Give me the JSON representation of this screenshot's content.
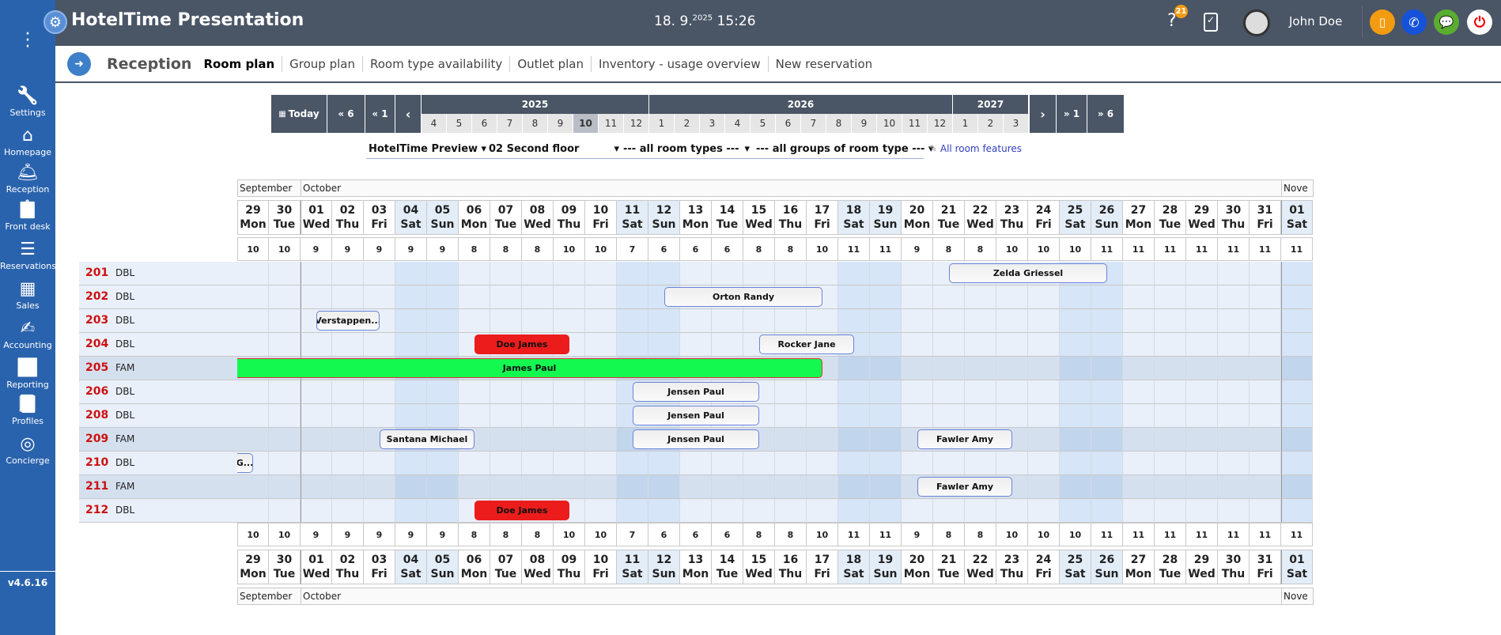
{
  "app": {
    "title": "HotelTime Presentation",
    "date": "18. 9.",
    "year": "2025",
    "time": "15:26",
    "help_badge": "21",
    "user": "John Doe",
    "version": "v4.6.16"
  },
  "colors": {
    "sidebar": "#2a63ad",
    "topbar": "#4a5566",
    "room_number": "#cc1111",
    "booking_red": "#ec1c1c",
    "booking_green": "#14f950",
    "booking_border": "#6a85d8",
    "weekend": "#e3edf8"
  },
  "sidebar": {
    "items": [
      {
        "label": "Settings",
        "icon": "wrench-icon"
      },
      {
        "label": "Homepage",
        "icon": "home-user-icon"
      },
      {
        "label": "Reception",
        "icon": "bell-icon"
      },
      {
        "label": "Front desk",
        "icon": "clipboard-check-icon"
      },
      {
        "label": "Reservations",
        "icon": "sliders-icon"
      },
      {
        "label": "Sales",
        "icon": "calculator-icon"
      },
      {
        "label": "Accounting",
        "icon": "pen-invoice-icon"
      },
      {
        "label": "Reporting",
        "icon": "chart-icon"
      },
      {
        "label": "Profiles",
        "icon": "phonebook-icon"
      },
      {
        "label": "Concierge",
        "icon": "target-icon"
      }
    ]
  },
  "nav": {
    "section": "Reception",
    "tabs": [
      "Room plan",
      "Group plan",
      "Room type availability",
      "Outlet plan",
      "Inventory - usage overview",
      "New reservation"
    ],
    "active": 0
  },
  "timeline": {
    "today": "Today",
    "back6": "6",
    "back1": "1",
    "fwd1": "1",
    "fwd6": "6",
    "years": [
      {
        "label": "2025",
        "months": [
          "4",
          "5",
          "6",
          "7",
          "8",
          "9",
          "10",
          "11",
          "12"
        ]
      },
      {
        "label": "2026",
        "months": [
          "1",
          "2",
          "3",
          "4",
          "5",
          "6",
          "7",
          "8",
          "9",
          "10",
          "11",
          "12"
        ]
      },
      {
        "label": "2027",
        "months": [
          "1",
          "2",
          "3"
        ]
      }
    ],
    "selected_month": "10",
    "selected_year": "2025"
  },
  "filters": {
    "hotel": "HotelTime Preview",
    "floor": "02 Second floor",
    "room_types": "--- all room types ---",
    "room_groups": "--- all groups of room type ---",
    "features": "All room features"
  },
  "plan": {
    "months": [
      {
        "label": "September",
        "span": 2
      },
      {
        "label": "October",
        "span": 31
      },
      {
        "label": "Nove",
        "span": 1
      }
    ],
    "days": [
      {
        "d": "29",
        "w": "Mon"
      },
      {
        "d": "30",
        "w": "Tue"
      },
      {
        "d": "01",
        "w": "Wed"
      },
      {
        "d": "02",
        "w": "Thu"
      },
      {
        "d": "03",
        "w": "Fri"
      },
      {
        "d": "04",
        "w": "Sat"
      },
      {
        "d": "05",
        "w": "Sun"
      },
      {
        "d": "06",
        "w": "Mon"
      },
      {
        "d": "07",
        "w": "Tue"
      },
      {
        "d": "08",
        "w": "Wed"
      },
      {
        "d": "09",
        "w": "Thu"
      },
      {
        "d": "10",
        "w": "Fri"
      },
      {
        "d": "11",
        "w": "Sat"
      },
      {
        "d": "12",
        "w": "Sun"
      },
      {
        "d": "13",
        "w": "Mon"
      },
      {
        "d": "14",
        "w": "Tue"
      },
      {
        "d": "15",
        "w": "Wed"
      },
      {
        "d": "16",
        "w": "Thu"
      },
      {
        "d": "17",
        "w": "Fri"
      },
      {
        "d": "18",
        "w": "Sat"
      },
      {
        "d": "19",
        "w": "Sun"
      },
      {
        "d": "20",
        "w": "Mon"
      },
      {
        "d": "21",
        "w": "Tue"
      },
      {
        "d": "22",
        "w": "Wed"
      },
      {
        "d": "23",
        "w": "Thu"
      },
      {
        "d": "24",
        "w": "Fri"
      },
      {
        "d": "25",
        "w": "Sat"
      },
      {
        "d": "26",
        "w": "Sun"
      },
      {
        "d": "27",
        "w": "Mon"
      },
      {
        "d": "28",
        "w": "Tue"
      },
      {
        "d": "29",
        "w": "Wed"
      },
      {
        "d": "30",
        "w": "Thu"
      },
      {
        "d": "31",
        "w": "Fri"
      },
      {
        "d": "01",
        "w": "Sat"
      }
    ],
    "first_date": "2025-09-29",
    "free_counts": [
      "10",
      "10",
      "9",
      "9",
      "9",
      "9",
      "9",
      "8",
      "8",
      "8",
      "10",
      "10",
      "7",
      "6",
      "6",
      "6",
      "8",
      "8",
      "10",
      "11",
      "11",
      "9",
      "8",
      "8",
      "10",
      "10",
      "10",
      "11",
      "11",
      "11",
      "11",
      "11",
      "11",
      "11"
    ],
    "rooms": [
      {
        "number": "201",
        "type": "DBL"
      },
      {
        "number": "202",
        "type": "DBL"
      },
      {
        "number": "203",
        "type": "DBL"
      },
      {
        "number": "204",
        "type": "DBL"
      },
      {
        "number": "205",
        "type": "FAM"
      },
      {
        "number": "206",
        "type": "DBL"
      },
      {
        "number": "208",
        "type": "DBL"
      },
      {
        "number": "209",
        "type": "FAM"
      },
      {
        "number": "210",
        "type": "DBL"
      },
      {
        "number": "211",
        "type": "FAM"
      },
      {
        "number": "212",
        "type": "DBL"
      }
    ],
    "bookings": [
      {
        "room": "201",
        "guest": "Zelda Griessel",
        "from": "2025-10-21",
        "to": "2025-10-26",
        "style": "default"
      },
      {
        "room": "202",
        "guest": "Orton Randy",
        "from": "2025-10-12",
        "to": "2025-10-17",
        "style": "default"
      },
      {
        "room": "203",
        "guest": "Verstappen...",
        "from": "2025-10-01",
        "to": "2025-10-03",
        "style": "default"
      },
      {
        "room": "204",
        "guest": "Doe James",
        "from": "2025-10-06",
        "to": "2025-10-09",
        "style": "red"
      },
      {
        "room": "204",
        "guest": "Rocker Jane",
        "from": "2025-10-15",
        "to": "2025-10-18",
        "style": "default"
      },
      {
        "room": "205",
        "guest": "James Paul",
        "from": null,
        "to": "2025-10-17",
        "style": "green"
      },
      {
        "room": "206",
        "guest": "Jensen Paul",
        "from": "2025-10-11",
        "to": "2025-10-15",
        "style": "default"
      },
      {
        "room": "208",
        "guest": "Jensen Paul",
        "from": "2025-10-11",
        "to": "2025-10-15",
        "style": "default"
      },
      {
        "room": "209",
        "guest": "Santana Michael",
        "from": "2025-10-03",
        "to": "2025-10-06",
        "style": "default"
      },
      {
        "room": "209",
        "guest": "Jensen Paul",
        "from": "2025-10-11",
        "to": "2025-10-15",
        "style": "default"
      },
      {
        "room": "209",
        "guest": "Fawler Amy",
        "from": "2025-10-20",
        "to": "2025-10-23",
        "style": "default"
      },
      {
        "room": "210",
        "guest": "G...",
        "from": null,
        "to": "2025-09-29",
        "style": "default"
      },
      {
        "room": "211",
        "guest": "Fawler Amy",
        "from": "2025-10-20",
        "to": "2025-10-23",
        "style": "default"
      },
      {
        "room": "212",
        "guest": "Doe James",
        "from": "2025-10-06",
        "to": "2025-10-09",
        "style": "red"
      }
    ]
  }
}
